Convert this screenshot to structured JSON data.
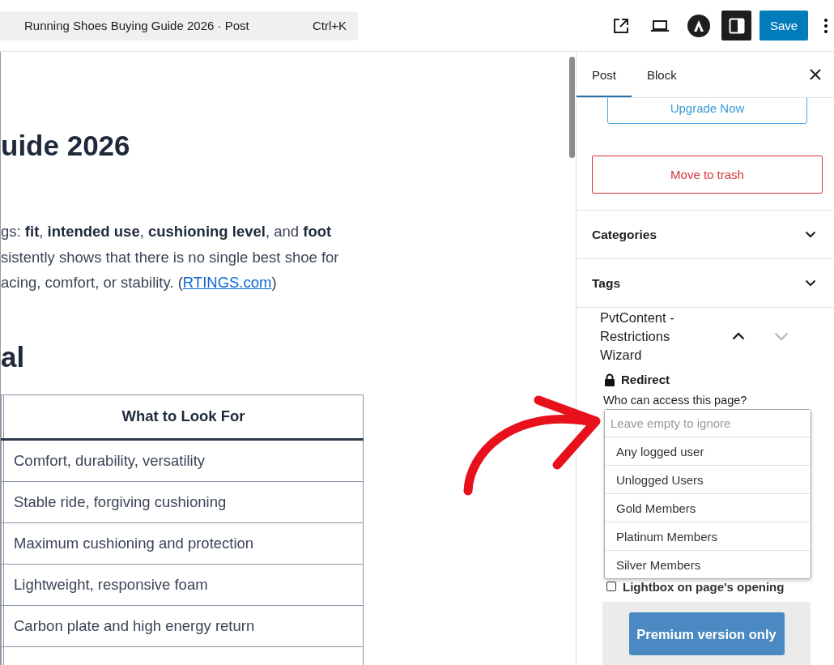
{
  "topbar": {
    "title": "Running Shoes Buying Guide 2026 · Post",
    "shortcut": "Ctrl+K",
    "save": "Save"
  },
  "editor": {
    "heading": "uide 2026",
    "paragraph_lines": [
      "gs: **fit**, **intended use**, **cushioning level**, and **foot**",
      "sistently shows that there is no single best shoe for"
    ],
    "last_line": {
      "before": "acing, comfort, or stability. (",
      "link": "RTINGS.com",
      "after": ")"
    },
    "subheading": "al",
    "table": {
      "columns": [
        "What to Look For"
      ],
      "rows": [
        [
          "Comfort, durability, versatility"
        ],
        [
          "Stable ride, forgiving cushioning"
        ],
        [
          "Maximum cushioning and protection"
        ],
        [
          "Lightweight, responsive foam"
        ],
        [
          "Carbon plate and high energy return"
        ]
      ]
    }
  },
  "sidebar": {
    "tabs": [
      {
        "label": "Post",
        "selected": true
      },
      {
        "label": "Block",
        "selected": false
      }
    ],
    "upgrade": "Upgrade Now",
    "trash": "Move to trash",
    "panels": [
      {
        "title": "Categories",
        "expanded": false
      },
      {
        "title": "Tags",
        "expanded": false
      }
    ],
    "wizard": {
      "title": "PvtContent - Restrictions Wizard",
      "expanded": true,
      "redirect": "Redirect",
      "question": "Who can access this page?",
      "select": {
        "placeholder": "Leave empty to ignore",
        "options": [
          "Any logged user",
          "Unlogged Users",
          "Gold Members",
          "Platinum Members",
          "Silver Members"
        ]
      },
      "lightbox": {
        "label": "Lightbox on page's opening",
        "checked": false
      },
      "premium": "Premium version only"
    }
  }
}
